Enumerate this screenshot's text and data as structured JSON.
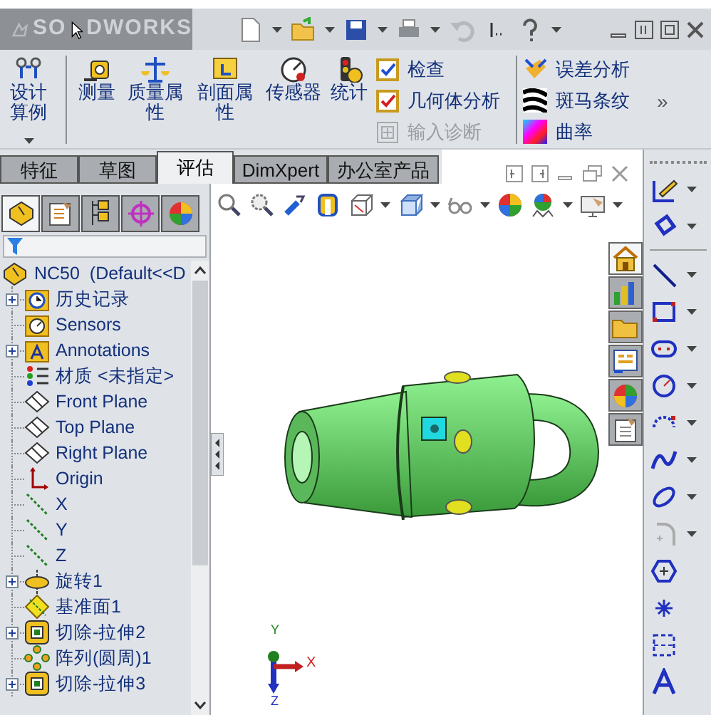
{
  "title_bar": {
    "logo_text": [
      "SO",
      "DWORKS"
    ]
  },
  "ribbon": {
    "tools": [
      {
        "kind": "study",
        "label": "设计算例",
        "dropdown": true
      },
      {
        "kind": "measure",
        "label": "测量",
        "dropdown": false
      },
      {
        "kind": "mass",
        "label": "质量属性",
        "dropdown": false
      },
      {
        "kind": "section",
        "label": "剖面属性",
        "dropdown": false
      },
      {
        "kind": "sensor",
        "label": "传感器",
        "dropdown": false
      },
      {
        "kind": "statistics",
        "label": "统计",
        "dropdown": false
      }
    ],
    "checks": [
      {
        "kind": "check",
        "label": "检查",
        "disabled": false
      },
      {
        "kind": "geometry",
        "label": "几何体分析",
        "disabled": false
      },
      {
        "kind": "import",
        "label": "输入诊断",
        "disabled": true
      }
    ],
    "analysis": [
      {
        "kind": "deviation",
        "label": "误差分析"
      },
      {
        "kind": "zebra",
        "label": "斑马条纹"
      },
      {
        "kind": "curvature",
        "label": "曲率"
      }
    ],
    "more": "»"
  },
  "command_tabs": [
    {
      "label": "特征",
      "selected": false
    },
    {
      "label": "草图",
      "selected": false
    },
    {
      "label": "评估",
      "selected": true
    },
    {
      "label": "DimXpert",
      "selected": false
    },
    {
      "label": "办公室产品",
      "selected": false
    }
  ],
  "panel_tabs": [
    {
      "kind": "tree",
      "selected": true
    },
    {
      "kind": "property",
      "selected": false
    },
    {
      "kind": "config",
      "selected": false
    },
    {
      "kind": "dimxpert",
      "selected": false
    },
    {
      "kind": "display",
      "selected": false
    }
  ],
  "tree": {
    "label": "NC50  (Default<<D",
    "kind": "part",
    "children": [
      {
        "label": "历史记录",
        "kind": "history",
        "collapsed": true
      },
      {
        "label": "Sensors",
        "kind": "sensors",
        "collapsed": false
      },
      {
        "label": "Annotations",
        "kind": "annotations",
        "collapsed": true
      },
      {
        "label": "材质 <未指定>",
        "kind": "material",
        "collapsed": false
      },
      {
        "label": "Front Plane",
        "kind": "plane",
        "collapsed": false
      },
      {
        "label": "Top Plane",
        "kind": "plane",
        "collapsed": false
      },
      {
        "label": "Right Plane",
        "kind": "plane",
        "collapsed": false
      },
      {
        "label": "Origin",
        "kind": "origin",
        "collapsed": false
      },
      {
        "label": "X",
        "kind": "axis",
        "collapsed": false
      },
      {
        "label": "Y",
        "kind": "axis",
        "collapsed": false
      },
      {
        "label": "Z",
        "kind": "axis",
        "collapsed": false
      },
      {
        "label": "旋转1",
        "kind": "revolve",
        "collapsed": true
      },
      {
        "label": "基准面1",
        "kind": "refplane",
        "collapsed": false
      },
      {
        "label": "切除-拉伸2",
        "kind": "cut",
        "collapsed": true
      },
      {
        "label": "阵列(圆周)1",
        "kind": "pattern",
        "collapsed": false
      },
      {
        "label": "切除-拉伸3",
        "kind": "cut",
        "collapsed": true
      }
    ]
  },
  "task_pane_tabs": [
    {
      "kind": "home",
      "selected": true
    },
    {
      "kind": "library",
      "selected": false
    },
    {
      "kind": "folder",
      "selected": false
    },
    {
      "kind": "palette",
      "selected": false
    },
    {
      "kind": "appearance",
      "selected": false
    },
    {
      "kind": "custom",
      "selected": false
    }
  ],
  "triad": {
    "x": "X",
    "y": "Y",
    "z": "Z"
  }
}
